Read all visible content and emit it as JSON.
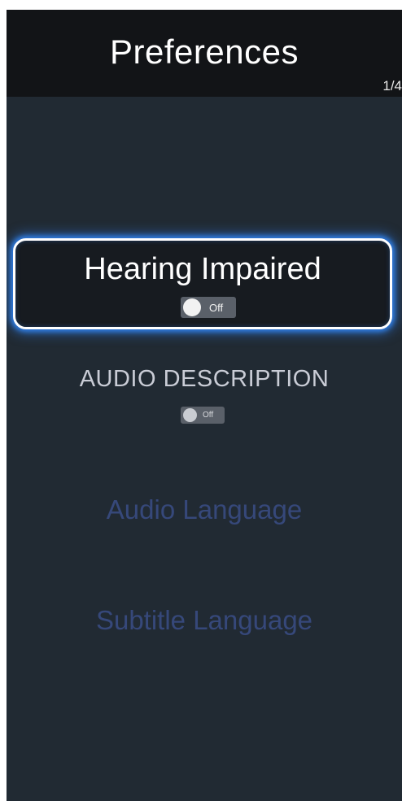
{
  "header": {
    "title": "Preferences",
    "page_indicator": "1/4"
  },
  "menu": {
    "hearing_impaired": {
      "label": "Hearing Impaired",
      "toggle_label": "Off",
      "focused": true
    },
    "audio_description": {
      "label": "AUDIO DESCRIPTION",
      "toggle_label": "Off"
    },
    "audio_language": {
      "label": "Audio Language"
    },
    "subtitle_language": {
      "label": "Subtitle Language"
    }
  },
  "colors": {
    "background": "#212a33",
    "header": "#121417",
    "focus_glow": "#2f7be0",
    "inactive_text": "#36487a"
  }
}
